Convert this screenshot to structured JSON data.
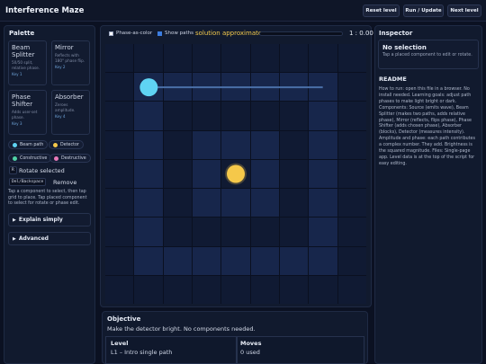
{
  "header": {
    "title": "Interference Maze",
    "buttons": {
      "reset": "Reset level",
      "run": "Run / Update",
      "next": "Next level"
    }
  },
  "palette": {
    "title": "Palette",
    "components": [
      {
        "name": "Beam\nSplitter",
        "desc": "50/50 split, relative phase.",
        "key": "Key 1"
      },
      {
        "name": "Mirror",
        "desc": "Reflects with 180° phase flip.",
        "key": "Key 2"
      },
      {
        "name": "Phase\nShifter",
        "desc": "Adds user-set phase.",
        "key": "Key 3"
      },
      {
        "name": "Absorber",
        "desc": "Zeroes amplitude.",
        "key": "Key 4"
      }
    ],
    "legend": [
      {
        "label": "Beam path",
        "color": "#5fd3f3"
      },
      {
        "label": "Detector",
        "color": "#f5c84a"
      },
      {
        "label": "Constructive",
        "color": "#4fd1a5"
      },
      {
        "label": "Destructive",
        "color": "#e879b9"
      }
    ],
    "shortcuts": [
      {
        "key": "R",
        "action": "Rotate selected"
      },
      {
        "key": "Del/Backspace",
        "action": "Remove"
      }
    ],
    "help": "Tap a component to select, then tap grid to place. Tap placed component to select for rotate or phase edit.",
    "details": [
      "Explain simply",
      "Advanced"
    ]
  },
  "board": {
    "phase_as_color": {
      "label": "Phase-as-color",
      "checked": false
    },
    "show_paths": {
      "label": "Show paths",
      "checked": true
    },
    "status": "solution approximate",
    "progress": 0.0,
    "timer": "1 : 0.00",
    "highlight_cells": [
      [
        1,
        1
      ],
      [
        1,
        2
      ],
      [
        1,
        3
      ],
      [
        1,
        4
      ],
      [
        1,
        5
      ],
      [
        1,
        6
      ],
      [
        1,
        7
      ],
      [
        2,
        1
      ],
      [
        2,
        7
      ],
      [
        3,
        1
      ],
      [
        3,
        3
      ],
      [
        3,
        4
      ],
      [
        3,
        5
      ],
      [
        3,
        7
      ],
      [
        4,
        1
      ],
      [
        4,
        3
      ],
      [
        4,
        5
      ],
      [
        4,
        7
      ],
      [
        5,
        1
      ],
      [
        5,
        3
      ],
      [
        5,
        4
      ],
      [
        5,
        5
      ],
      [
        5,
        7
      ],
      [
        6,
        1
      ],
      [
        6,
        7
      ],
      [
        7,
        1
      ],
      [
        7,
        2
      ],
      [
        7,
        3
      ],
      [
        7,
        4
      ],
      [
        7,
        5
      ],
      [
        7,
        6
      ],
      [
        7,
        7
      ]
    ],
    "source": {
      "row": 1,
      "col": 1
    },
    "beam_end_col": 7,
    "detector": {
      "row": 4,
      "col": 4
    }
  },
  "objective": {
    "title": "Objective",
    "text": "Make the detector bright. No components needed.",
    "level_label": "Level",
    "level_value": "L1 – Intro single path",
    "moves_label": "Moves",
    "moves_value": "0 used"
  },
  "inspector": {
    "title": "Inspector",
    "selection_title": "No selection",
    "selection_text": "Tap a placed component to edit or rotate.",
    "readme_title": "README",
    "readme_text": "How to run: open this file in a browser. No install needed. Learning goals: adjust path phases to make light bright or dark. Components: Source (emits wave), Beam Splitter (makes two paths, adds relative phase), Mirror (reflects, flips phase), Phase Shifter (adds chosen phase), Absorber (blocks), Detector (measures intensity). Amplitude and phase: each path contributes a complex number. They add. Brightness is the squared magnitude. Files: Single-page app. Level data is at the top of the script for easy editing."
  }
}
